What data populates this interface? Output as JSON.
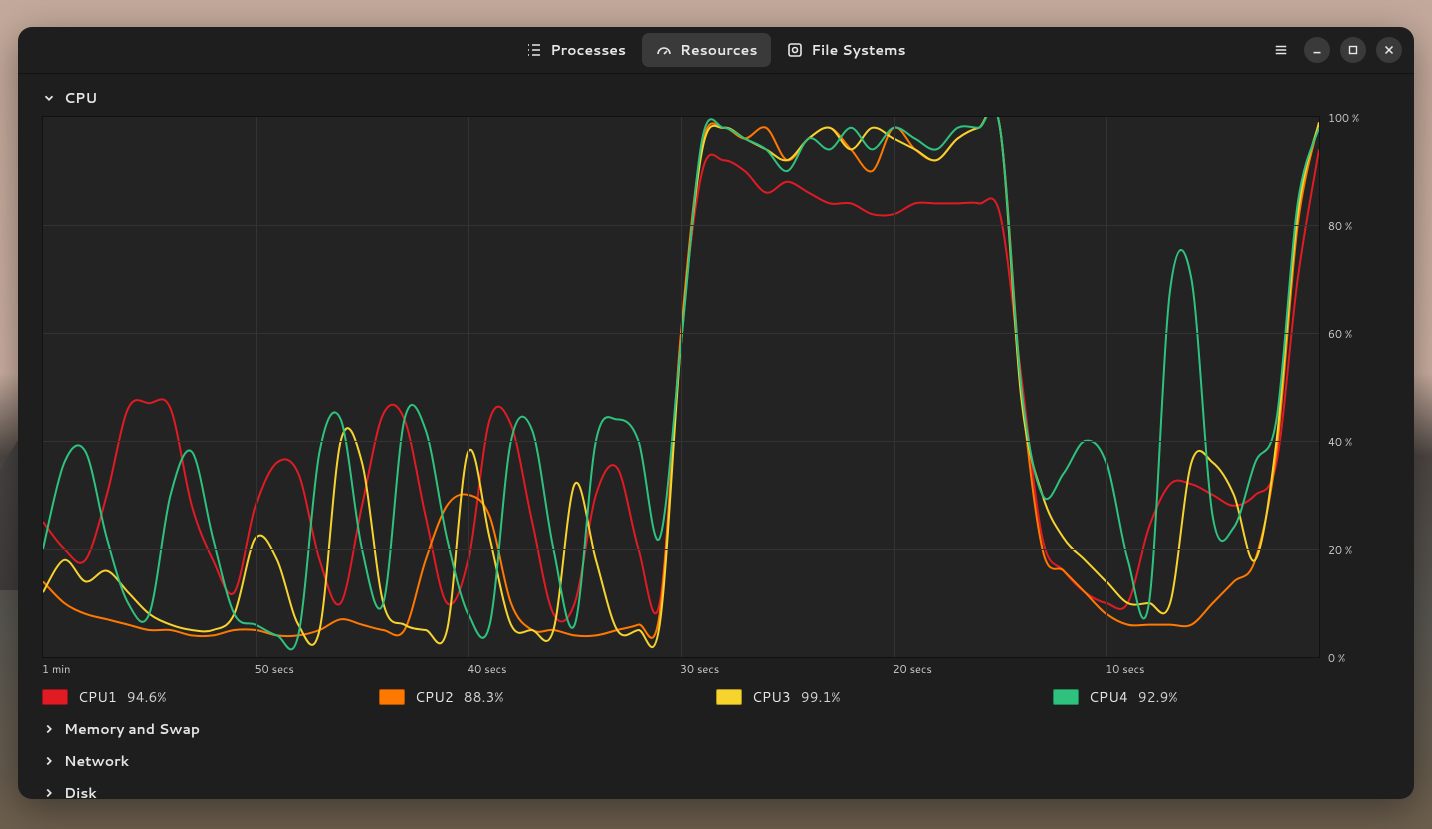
{
  "tabs": {
    "processes": "Processes",
    "resources": "Resources",
    "filesystems": "File Systems"
  },
  "sections": {
    "cpu": "CPU",
    "memory": "Memory and Swap",
    "network": "Network",
    "disk": "Disk"
  },
  "legend": [
    {
      "name": "CPU1",
      "value": "94.6%",
      "color": "#e01b24"
    },
    {
      "name": "CPU2",
      "value": "88.3%",
      "color": "#ff7800"
    },
    {
      "name": "CPU3",
      "value": "99.1%",
      "color": "#f6d32d"
    },
    {
      "name": "CPU4",
      "value": "92.9%",
      "color": "#2ec27e"
    }
  ],
  "chart_data": {
    "type": "line",
    "title": "CPU",
    "xlabel": "",
    "ylabel": "",
    "xlim": [
      0,
      60
    ],
    "ylim": [
      0,
      100
    ],
    "x_ticks": [
      "1 min",
      "50 secs",
      "40 secs",
      "30 secs",
      "20 secs",
      "10 secs"
    ],
    "y_ticks": [
      "100 %",
      "80 %",
      "60 %",
      "40 %",
      "20 %",
      "0 %"
    ],
    "x": [
      60,
      59,
      58,
      57,
      56,
      55,
      54,
      53,
      52,
      51,
      50,
      49,
      48,
      47,
      46,
      45,
      44,
      43,
      42,
      41,
      40,
      39,
      38,
      37,
      36,
      35,
      34,
      33,
      32,
      31,
      30,
      29,
      28,
      27,
      26,
      25,
      24,
      23,
      22,
      21,
      20,
      19,
      18,
      17,
      16,
      15,
      14,
      13,
      12,
      11,
      10,
      9,
      8,
      7,
      6,
      5,
      4,
      3,
      2,
      1,
      0
    ],
    "series": [
      {
        "name": "CPU1",
        "color": "#e01b24",
        "values": [
          25,
          20,
          18,
          30,
          46,
          47,
          46,
          28,
          18,
          12,
          28,
          36,
          34,
          18,
          10,
          28,
          45,
          44,
          26,
          10,
          18,
          44,
          43,
          25,
          8,
          10,
          30,
          35,
          20,
          10,
          60,
          90,
          92,
          90,
          86,
          88,
          86,
          84,
          84,
          82,
          82,
          84,
          84,
          84,
          84,
          82,
          52,
          22,
          16,
          12,
          10,
          10,
          24,
          32,
          32,
          30,
          28,
          30,
          36,
          70,
          94
        ]
      },
      {
        "name": "CPU2",
        "color": "#ff7800",
        "values": [
          14,
          10,
          8,
          7,
          6,
          5,
          5,
          4,
          4,
          5,
          5,
          4,
          4,
          5,
          7,
          6,
          5,
          5,
          18,
          28,
          30,
          26,
          10,
          5,
          5,
          4,
          4,
          5,
          6,
          8,
          60,
          95,
          98,
          96,
          98,
          92,
          96,
          98,
          94,
          90,
          98,
          94,
          92,
          96,
          98,
          98,
          50,
          20,
          16,
          12,
          8,
          6,
          6,
          6,
          6,
          10,
          14,
          18,
          38,
          80,
          99
        ]
      },
      {
        "name": "CPU3",
        "color": "#f6d32d",
        "values": [
          12,
          18,
          14,
          16,
          12,
          8,
          6,
          5,
          5,
          8,
          22,
          18,
          6,
          5,
          40,
          36,
          10,
          6,
          5,
          5,
          38,
          22,
          6,
          5,
          5,
          32,
          18,
          5,
          5,
          6,
          58,
          94,
          98,
          96,
          94,
          92,
          96,
          98,
          94,
          98,
          96,
          94,
          92,
          96,
          98,
          98,
          48,
          30,
          22,
          18,
          14,
          10,
          10,
          10,
          36,
          36,
          30,
          18,
          40,
          82,
          99
        ]
      },
      {
        "name": "CPU4",
        "color": "#2ec27e",
        "values": [
          20,
          36,
          38,
          22,
          10,
          8,
          30,
          38,
          22,
          8,
          6,
          4,
          4,
          38,
          44,
          20,
          10,
          44,
          42,
          22,
          8,
          6,
          40,
          42,
          20,
          6,
          40,
          44,
          40,
          22,
          58,
          96,
          98,
          96,
          94,
          90,
          96,
          94,
          98,
          94,
          98,
          96,
          94,
          98,
          98,
          98,
          50,
          30,
          34,
          40,
          36,
          18,
          10,
          68,
          70,
          26,
          24,
          36,
          44,
          84,
          98
        ]
      }
    ]
  }
}
